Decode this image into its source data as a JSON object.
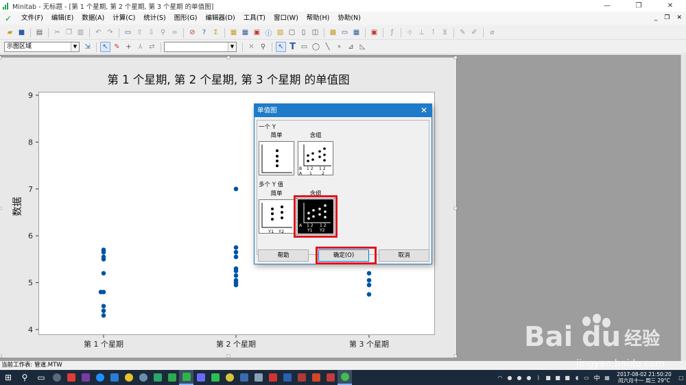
{
  "window": {
    "title": "Minitab - 无标题 - [第 1 个星期, 第 2 个星期, 第 3 个星期 的单值图]",
    "minimize": "—",
    "restore": "❐",
    "close": "✕"
  },
  "menubar": {
    "items": [
      "文件(F)",
      "编辑(E)",
      "数据(A)",
      "计算(C)",
      "统计(S)",
      "图形(G)",
      "编辑器(D)",
      "工具(T)",
      "窗口(W)",
      "帮助(H)",
      "协助(N)"
    ],
    "mdi_minimize": "_",
    "mdi_restore": "❐",
    "mdi_close": "✕"
  },
  "toolbar2": {
    "region_select": "示图区域",
    "font_select": ""
  },
  "chart_data": {
    "type": "scatter",
    "title": "第 1 个星期, 第 2 个星期, 第 3 个星期 的单值图",
    "ylabel": "数据",
    "xlabel": "",
    "categories": [
      "第 1 个星期",
      "第 2 个星期",
      "第 3 个星期"
    ],
    "ylim": [
      4,
      9
    ],
    "yticks": [
      "4",
      "5",
      "6",
      "7",
      "8",
      "9"
    ],
    "series": [
      {
        "values": [
          5.7,
          5.65,
          5.55,
          5.5,
          5.2,
          4.8,
          4.8,
          4.5,
          4.4,
          4.3
        ]
      },
      {
        "values": [
          7.0,
          5.75,
          5.65,
          5.55,
          5.3,
          5.25,
          5.15,
          5.05,
          5.0,
          4.95
        ]
      },
      {
        "values": [
          5.2,
          5.05,
          4.95,
          4.75
        ]
      }
    ],
    "point_color": "#0054a6",
    "grid": false
  },
  "dialog": {
    "title": "单值图",
    "close": "✕",
    "group_one_y": "一个 Y",
    "group_multi_y": "多个 Y 值",
    "opt_simple": "简单",
    "opt_group": "含组",
    "opt_simple_multi": "简单",
    "opt_group_multi": "含组",
    "thumb_labels": {
      "one_group_b": "B",
      "one_group_a": "A",
      "one_group_t1": "1 2",
      "one_group_t2": "1 2",
      "one_group_b1": "1",
      "one_group_b2": "2",
      "multi_simple_y1": "Y1",
      "multi_simple_y2": "Y2",
      "multi_group_a": "A",
      "multi_group_t1": "1 2",
      "multi_group_t2": "1 2",
      "multi_group_y1": "Y1",
      "multi_group_y2": "Y2"
    },
    "help_button": "帮助",
    "ok_button": "确定(O)",
    "cancel_button": "取消",
    "highlight_color": "#e0141e"
  },
  "statusbar": {
    "text": "当前工作表: 管道.MTW"
  },
  "taskbar": {
    "start_icon": "windows-icon",
    "lang": "中",
    "time": "2017-08-02  21:50:20",
    "date": "闰六月十一  周三  29°C"
  },
  "watermark": {
    "brand": "Bai",
    "brand2": "du",
    "cn": "经验",
    "url": "jingyan.baidu.com"
  }
}
